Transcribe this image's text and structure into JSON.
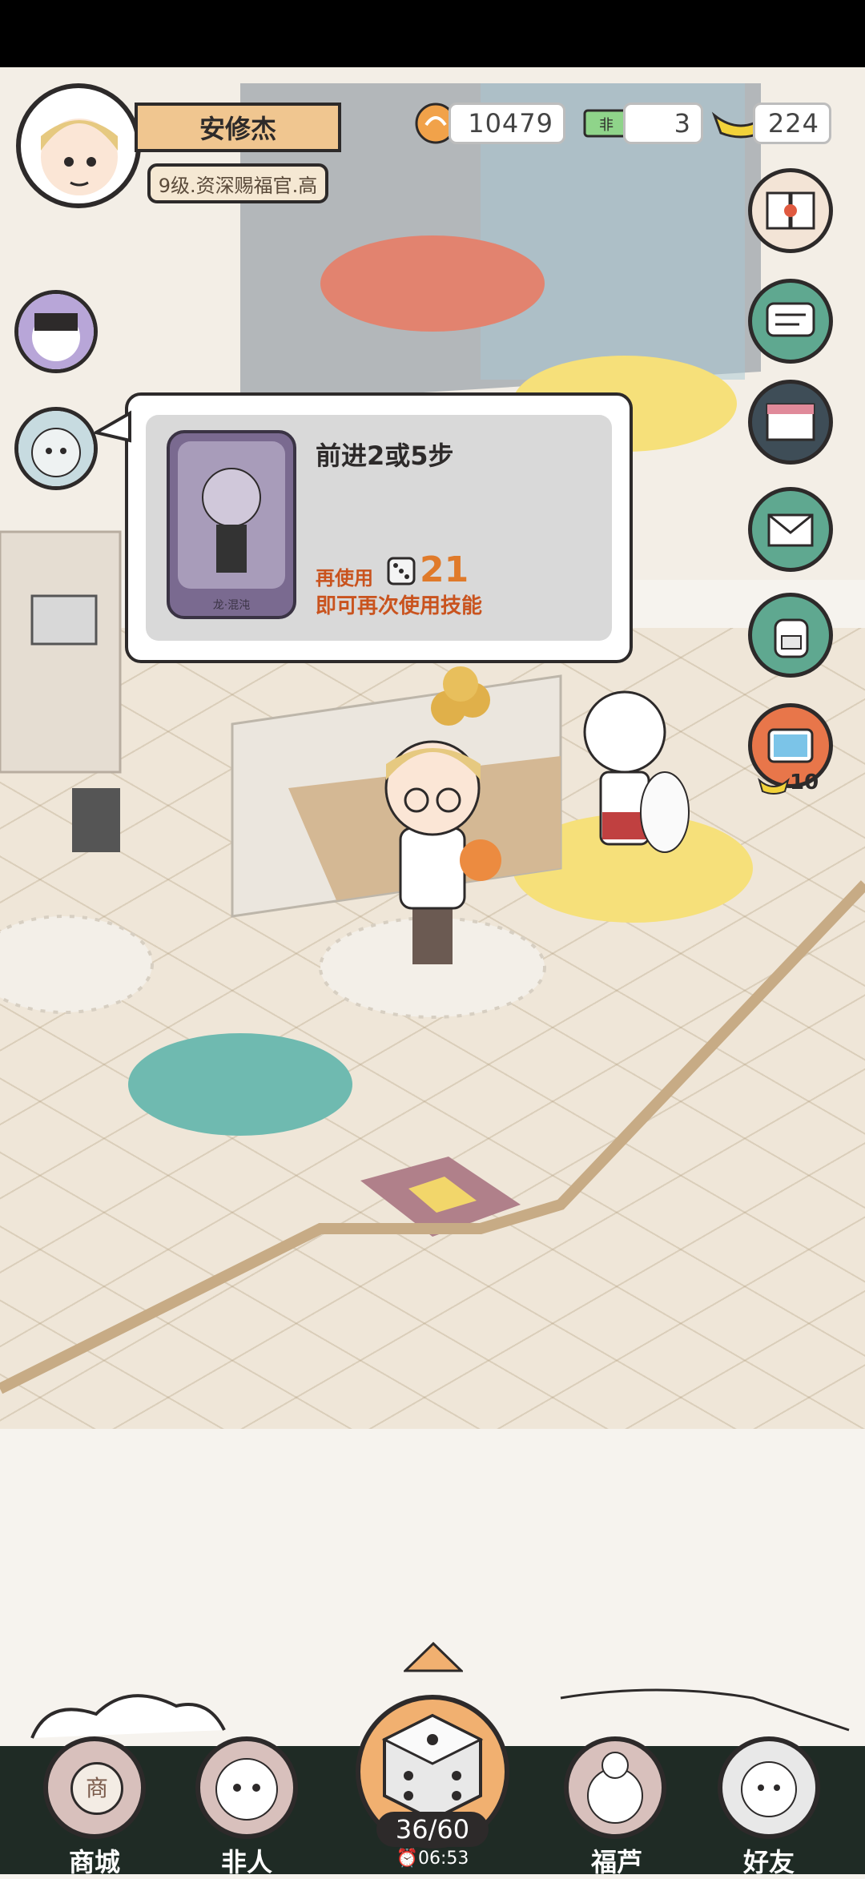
{
  "player": {
    "name": "安修杰",
    "rank": "9级.资深赐福官.高"
  },
  "currencies": {
    "clouds": "10479",
    "tickets": "3",
    "gold": "224"
  },
  "skill_popup": {
    "title": "前进2或5步",
    "card_label": "龙·混沌",
    "reuse_prefix": "再使用",
    "reuse_count": "21",
    "reuse_suffix": "即可再次使用技能"
  },
  "side_menu": {
    "shop_ad_cost": "10"
  },
  "bottom_nav": {
    "shop": "商城",
    "shop_glyph": "商",
    "feiren": "非人",
    "dice_count": "36/60",
    "timer": "⏰06:53",
    "fulu": "福芦",
    "friends": "好友"
  },
  "colors": {
    "accent_orange": "#f1b070",
    "name_plate": "#f0c690",
    "skill_text": "#c9531e"
  }
}
